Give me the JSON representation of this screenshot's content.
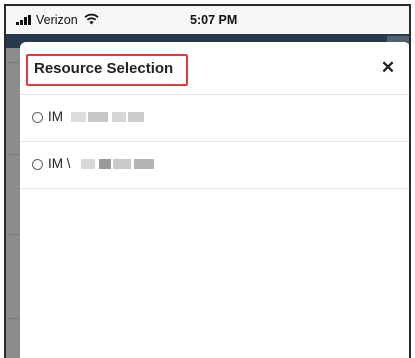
{
  "status_bar": {
    "carrier": "Verizon",
    "time": "5:07 PM"
  },
  "icons": {
    "signal": "cellular-signal-icon",
    "wifi": "wifi-icon",
    "close": "close-icon"
  },
  "colors": {
    "highlight": "#e0393e",
    "app_header": "#2a3a4e"
  },
  "modal": {
    "title": "Resource Selection",
    "close_label": "✕",
    "options": [
      {
        "label": "IM",
        "selected": false
      },
      {
        "label": "IM \\",
        "selected": false
      }
    ]
  }
}
